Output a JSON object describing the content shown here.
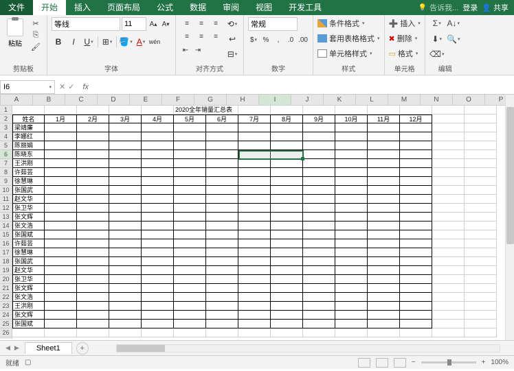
{
  "tabs": {
    "file": "文件",
    "home": "开始",
    "insert": "插入",
    "layout": "页面布局",
    "formulas": "公式",
    "data": "数据",
    "review": "审阅",
    "view": "视图",
    "dev": "开发工具",
    "tellme": "告诉我...",
    "login": "登录",
    "share": "共享"
  },
  "ribbon": {
    "clipboard": {
      "label": "剪贴板",
      "paste": "粘贴"
    },
    "font": {
      "label": "字体",
      "name": "等线",
      "size": "11"
    },
    "align": {
      "label": "对齐方式"
    },
    "number": {
      "label": "数字",
      "format": "常规"
    },
    "styles": {
      "label": "样式",
      "cond": "条件格式",
      "tbl": "套用表格格式",
      "cell": "单元格样式"
    },
    "cells": {
      "label": "单元格",
      "insert": "插入",
      "delete": "删除",
      "format": "格式"
    },
    "editing": {
      "label": "编辑"
    }
  },
  "namebox": "I6",
  "sheet": {
    "title": "2020全年销量汇总表",
    "headers": [
      "姓名",
      "1月",
      "2月",
      "3月",
      "4月",
      "5月",
      "6月",
      "7月",
      "8月",
      "9月",
      "10月",
      "11月",
      "12月"
    ],
    "names": [
      "梁靖廉",
      "李娜红",
      "陈丽娟",
      "陈晓东",
      "王洪刚",
      "许茹芸",
      "徐慧琳",
      "张国武",
      "赵文华",
      "张卫华",
      "张文辉",
      "张文浩",
      "张国斌",
      "许茹芸",
      "徐慧琳",
      "张国武",
      "赵文华",
      "张卫华",
      "张文辉",
      "张文浩",
      "王洪刚",
      "张文辉",
      "张国斌"
    ],
    "cols": [
      "A",
      "B",
      "C",
      "D",
      "E",
      "F",
      "G",
      "H",
      "I",
      "J",
      "K",
      "L",
      "M",
      "N",
      "O",
      "P"
    ],
    "tab": "Sheet1"
  },
  "status": {
    "ready": "就绪",
    "zoom": "100%"
  }
}
